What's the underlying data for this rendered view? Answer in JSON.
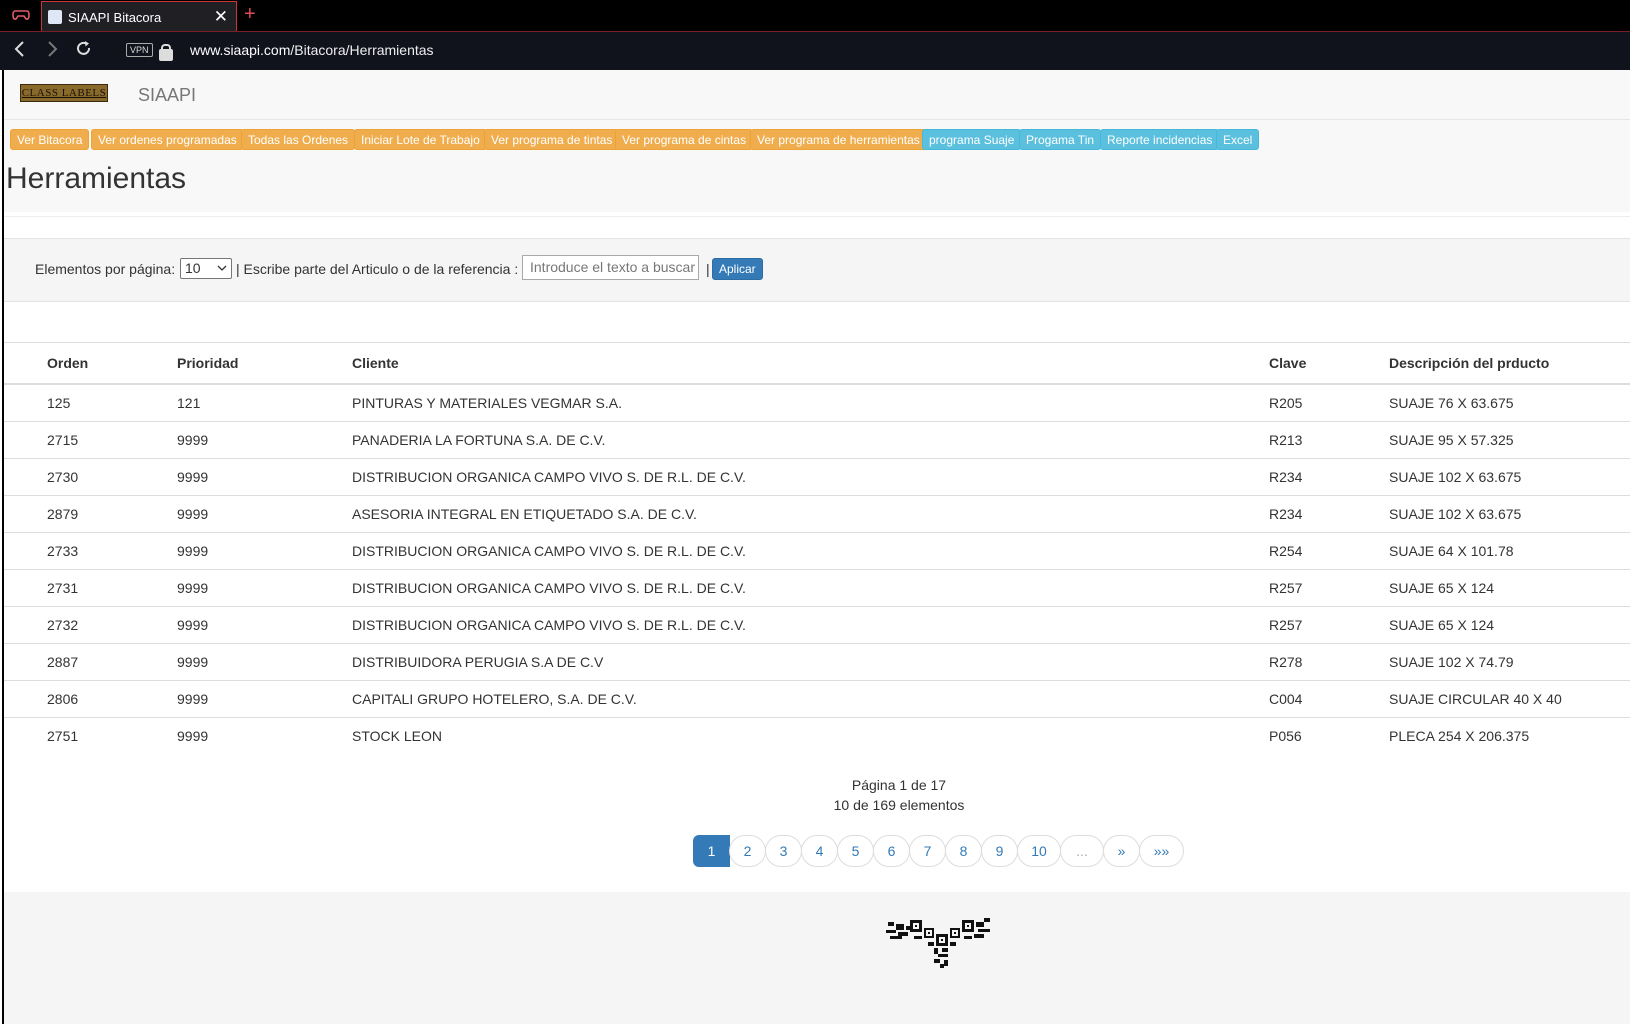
{
  "browser": {
    "tab_title": "SIAAPI Bitacora",
    "new_tab": "+",
    "close": "✕",
    "vpn": "VPN",
    "url_domain": "www.siaapi.com",
    "url_path": "/Bitacora/Herramientas"
  },
  "header": {
    "logo_text": "CLASS LABELS",
    "brand": "SIAAPI"
  },
  "menu": [
    {
      "label": "Ver Bitacora",
      "style": "warning"
    },
    {
      "label": "Ver ordenes programadas",
      "style": "warning"
    },
    {
      "label": "Todas las Ordenes",
      "style": "warning"
    },
    {
      "label": "Iniciar Lote de Trabajo",
      "style": "warning"
    },
    {
      "label": "Ver programa de tintas",
      "style": "warning"
    },
    {
      "label": "Ver programa de cintas",
      "style": "warning"
    },
    {
      "label": "Ver programa de herramientas",
      "style": "warning"
    },
    {
      "label": "programa Suaje",
      "style": "info"
    },
    {
      "label": "Progama Tin",
      "style": "info"
    },
    {
      "label": "Reporte incidencias",
      "style": "info"
    },
    {
      "label": "Excel",
      "style": "info"
    }
  ],
  "page_title": "Herramientas",
  "filter": {
    "per_page_label": "Elementos por página:",
    "per_page_value": "10",
    "search_label": "| Escribe parte del Articulo o de la referencia :",
    "search_placeholder": "Introduce el texto a buscar",
    "separator": "|",
    "apply_label": "Aplicar"
  },
  "table": {
    "columns": [
      "Orden",
      "Prioridad",
      "Cliente",
      "Clave",
      "Descripción del prducto"
    ],
    "rows": [
      [
        "125",
        "121",
        "PINTURAS Y MATERIALES VEGMAR S.A.",
        "R205",
        "SUAJE 76 X 63.675"
      ],
      [
        "2715",
        "9999",
        "PANADERIA LA FORTUNA S.A. DE C.V.",
        "R213",
        "SUAJE 95 X 57.325"
      ],
      [
        "2730",
        "9999",
        "DISTRIBUCION ORGANICA CAMPO VIVO S. DE R.L. DE C.V.",
        "R234",
        "SUAJE 102 X 63.675"
      ],
      [
        "2879",
        "9999",
        "ASESORIA INTEGRAL EN ETIQUETADO S.A. DE C.V.",
        "R234",
        "SUAJE 102 X 63.675"
      ],
      [
        "2733",
        "9999",
        "DISTRIBUCION ORGANICA CAMPO VIVO S. DE R.L. DE C.V.",
        "R254",
        "SUAJE 64 X 101.78"
      ],
      [
        "2731",
        "9999",
        "DISTRIBUCION ORGANICA CAMPO VIVO S. DE R.L. DE C.V.",
        "R257",
        "SUAJE 65 X 124"
      ],
      [
        "2732",
        "9999",
        "DISTRIBUCION ORGANICA CAMPO VIVO S. DE R.L. DE C.V.",
        "R257",
        "SUAJE 65 X 124"
      ],
      [
        "2887",
        "9999",
        "DISTRIBUIDORA PERUGIA S.A DE C.V",
        "R278",
        "SUAJE 102 X 74.79"
      ],
      [
        "2806",
        "9999",
        "CAPITALI GRUPO HOTELERO, S.A. DE C.V.",
        "C004",
        "SUAJE CIRCULAR 40 X 40"
      ],
      [
        "2751",
        "9999",
        "STOCK LEON",
        "P056",
        "PLECA 254 X 206.375"
      ]
    ]
  },
  "pagination": {
    "page_info": "Página 1 de 17",
    "count_info": "10 de 169 elementos",
    "pages": [
      "1",
      "2",
      "3",
      "4",
      "5",
      "6",
      "7",
      "8",
      "9",
      "10",
      "...",
      "»",
      "»»"
    ],
    "active": "1"
  },
  "colors": {
    "warning": "#f0ad4e",
    "info": "#5bc0de",
    "primary": "#337ab7"
  }
}
